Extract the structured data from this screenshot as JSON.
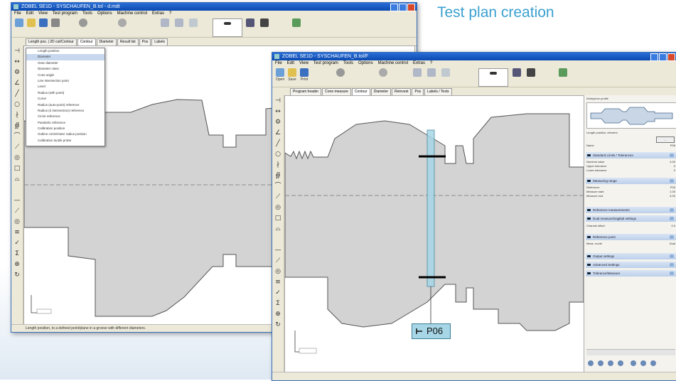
{
  "heading": "Test plan creation",
  "back_window": {
    "title": "ZOBEL SE1D - SYSCHAUFEN_B.tol - d.mdt",
    "menu": [
      "File",
      "Edit",
      "View",
      "Test program",
      "Tools",
      "Options",
      "Machine control",
      "Extras",
      "?"
    ],
    "dropdown_items": [
      "Length position",
      "Diameter",
      "Gear diameter",
      "Diameter class",
      "Cone angle",
      "Line intersection point",
      "Level",
      "Radius (with point)",
      "Curve",
      "Radius (auto-point) reference",
      "Radius (2 intersection) reference",
      "Circle reference",
      "Parabolic reference",
      "Calibration position",
      "Outline circle/Outer radius position",
      "Calibration tactile probe"
    ],
    "dropdown_selected": 1,
    "status": "Length position, to a defined point/plane in a groove with different diameters."
  },
  "front_window": {
    "title": "ZOBEL SE1D - SYSCHAUFEN_B.tol/F",
    "menu": [
      "File",
      "Edit",
      "View",
      "Test program",
      "Tools",
      "Options",
      "Machine control",
      "Extras",
      "?"
    ],
    "toolbar": [
      "Open",
      "Save",
      "Print",
      "Cycle",
      "Run",
      "Mode",
      "Zoom",
      "Zoom 2D",
      "Zoom 3D",
      "Ref",
      "Diff position",
      "Display 3D",
      "Position",
      "Teach position"
    ],
    "tabs": [
      "Program header",
      "Cone measure",
      "Contour",
      "Diameter",
      "Reinvest",
      "Pos",
      "Labels / Texts"
    ],
    "right_panel": {
      "top_label": "Workpiece profile",
      "sections": [
        "Standard Limits / Tolerances",
        "Measuring range",
        "Reference measurements",
        "Dual measure/Sagittal settings",
        "Reference point",
        "Output settings",
        "Advanced Settings",
        "Tolerance/Measure"
      ],
      "fields": [
        {
          "label": "Length position, element",
          "value": ""
        },
        {
          "label": "Name",
          "value": "P06"
        },
        {
          "label": "Nominal value",
          "value": "4.00"
        },
        {
          "label": "Upper tolerance",
          "value": "0"
        },
        {
          "label": "Lower tolerance",
          "value": "0"
        },
        {
          "label": "Reference",
          "value": "P03"
        },
        {
          "label": "Measure start",
          "value": "1.00"
        },
        {
          "label": "Measure end",
          "value": "4.00"
        },
        {
          "label": "Channel offset",
          "value": "0.0"
        },
        {
          "label": "Meas. mode",
          "value": "Dual"
        }
      ]
    },
    "callout_label": "P06"
  },
  "colors": {
    "title_bar": "#0b4ab0",
    "part_fill": "#d3d3d3",
    "callout_fill": "#a7d6e6",
    "heading": "#3aa0d0"
  }
}
